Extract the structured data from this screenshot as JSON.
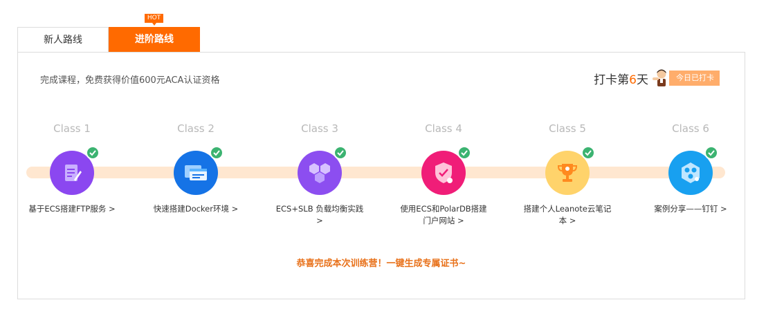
{
  "hot_badge": "HOT",
  "tabs": [
    {
      "label": "新人路线",
      "active": false
    },
    {
      "label": "进阶路线",
      "active": true
    }
  ],
  "panel": {
    "subtitle": "完成课程，免费获得价值600元ACA认证资格",
    "checkin": {
      "prefix": "打卡第",
      "days": "6",
      "suffix": "天",
      "button": "今日已打卡"
    },
    "steps": [
      {
        "class_label": "Class 1",
        "name": "基于ECS搭建FTP服务 >",
        "icon": "document-edit-icon",
        "color": "#8b47f0",
        "completed": true
      },
      {
        "class_label": "Class 2",
        "name": "快速搭建Docker环境 >",
        "icon": "server-window-icon",
        "color": "#1573e6",
        "completed": true
      },
      {
        "class_label": "Class 3",
        "name": "ECS+SLB 负载均衡实践 >",
        "icon": "cubes-icon",
        "color": "#8c4ef0",
        "completed": true
      },
      {
        "class_label": "Class 4",
        "name": "使用ECS和PolarDB搭建门户网站 >",
        "icon": "shield-icon",
        "color": "#f01d78",
        "completed": true
      },
      {
        "class_label": "Class 5",
        "name": "搭建个人Leanote云笔记本 >",
        "icon": "trophy-icon",
        "color": "#ffd36b",
        "completed": true
      },
      {
        "class_label": "Class 6",
        "name": "案例分享——钉钉 >",
        "icon": "hexagon-network-icon",
        "color": "#18a0f0",
        "completed": true
      }
    ],
    "congrats": "恭喜完成本次训练营！一键生成专属证书~"
  },
  "colors": {
    "accent": "#ff6a00",
    "track": "#ffe7d0",
    "check_badge": "#3cb371"
  }
}
